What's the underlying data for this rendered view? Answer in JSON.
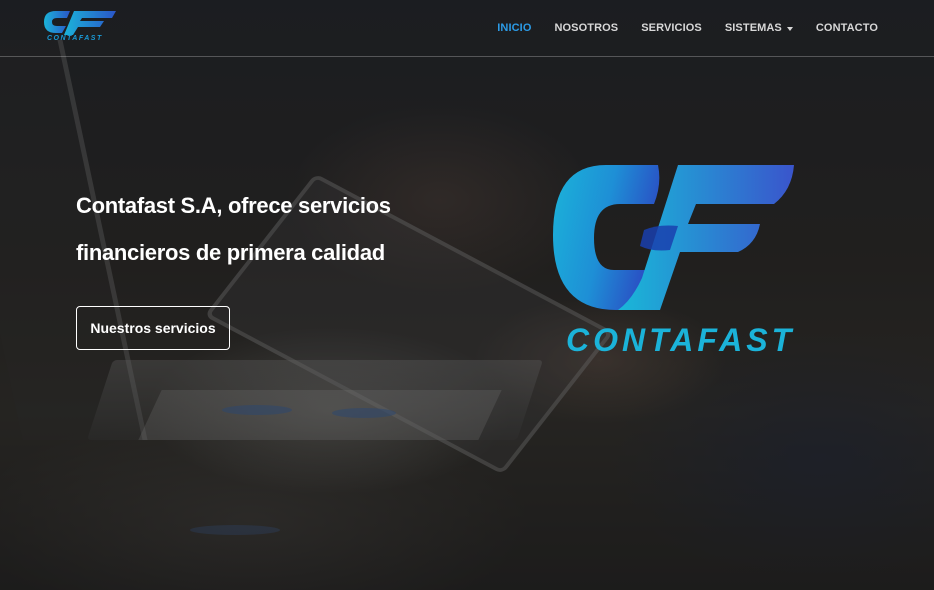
{
  "brand": {
    "name": "CONTAFAST",
    "colors": {
      "cyan": "#1bb3d9",
      "blue": "#2a55c8",
      "nav_active": "#2b9be6"
    }
  },
  "nav": {
    "items": [
      {
        "label": "INICIO",
        "active": true
      },
      {
        "label": "NOSOTROS",
        "active": false
      },
      {
        "label": "SERVICIOS",
        "active": false
      },
      {
        "label": "SISTEMAS",
        "active": false,
        "has_dropdown": true,
        "icon": "caret-down-icon"
      },
      {
        "label": "CONTACTO",
        "active": false
      }
    ]
  },
  "hero": {
    "headline_line1": "Contafast S.A, ofrece servicios",
    "headline_line2": "financieros de primera calidad",
    "cta_label": "Nuestros servicios",
    "logo_text": "CONTAFAST"
  }
}
